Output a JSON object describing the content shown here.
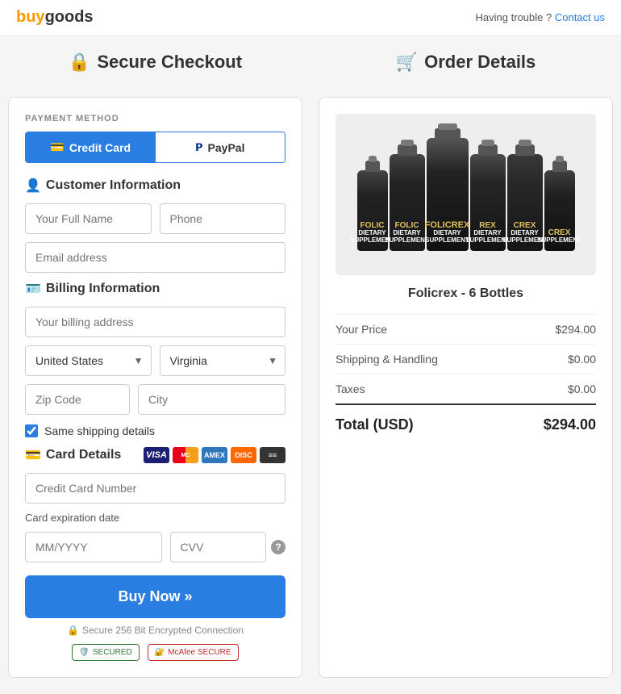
{
  "header": {
    "logo": "buygoods",
    "trouble_text": "Having trouble ?",
    "contact_text": "Contact us"
  },
  "left_panel": {
    "payment_method_label": "PAYMENT METHOD",
    "tab_credit_card": "Credit Card",
    "tab_paypal": "PayPal",
    "customer_info_title": "Customer Information",
    "full_name_placeholder": "Your Full Name",
    "phone_placeholder": "Phone",
    "email_placeholder": "Email address",
    "billing_info_title": "Billing Information",
    "billing_address_placeholder": "Your billing address",
    "country_default": "United States",
    "state_default": "Virginia",
    "zip_placeholder": "Zip Code",
    "city_placeholder": "City",
    "same_shipping_label": "Same shipping details",
    "card_details_title": "Card Details",
    "card_number_placeholder": "Credit Card Number",
    "expiry_label": "Card expiration date",
    "expiry_placeholder": "MM/YYYY",
    "cvv_placeholder": "CVV",
    "buy_btn_label": "Buy Now »",
    "secure_text": "Secure 256 Bit Encrypted Connection",
    "badge_secured": "SECURED",
    "badge_mcafee": "McAfee SECURE"
  },
  "right_panel": {
    "title": "Order Details",
    "product_name": "Folicrex - 6 Bottles",
    "your_price_label": "Your Price",
    "your_price_value": "$294.00",
    "shipping_label": "Shipping & Handling",
    "shipping_value": "$0.00",
    "taxes_label": "Taxes",
    "taxes_value": "$0.00",
    "total_label": "Total (USD)",
    "total_value": "$294.00"
  },
  "icons": {
    "lock": "🔒",
    "cart": "🛒",
    "user": "👤",
    "id_card": "🪪",
    "credit_card": "💳"
  }
}
